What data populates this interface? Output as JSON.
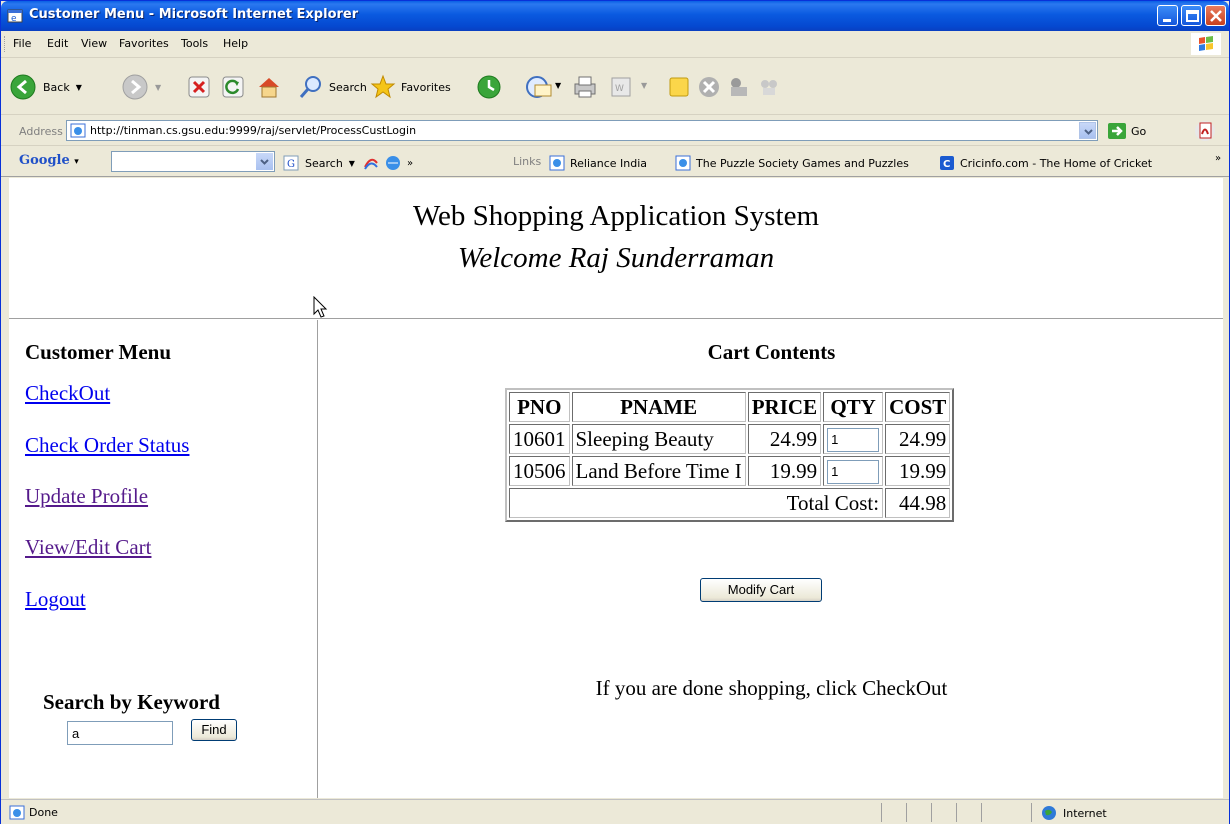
{
  "window": {
    "title": "Customer Menu - Microsoft Internet Explorer"
  },
  "menubar": {
    "items": [
      "File",
      "Edit",
      "View",
      "Favorites",
      "Tools",
      "Help"
    ]
  },
  "toolbar": {
    "back_label": "Back",
    "search_label": "Search",
    "favorites_label": "Favorites"
  },
  "addressbar": {
    "label": "Address",
    "url": "http://tinman.cs.gsu.edu:9999/raj/servlet/ProcessCustLogin",
    "go_label": "Go"
  },
  "googlebar": {
    "logo": "Google",
    "search_label": "Search",
    "links_label": "Links",
    "links": [
      "Reliance India",
      "The Puzzle Society Games and Puzzles",
      "Cricinfo.com - The Home of Cricket"
    ]
  },
  "page": {
    "header_title": "Web Shopping Application System",
    "welcome": "Welcome Raj Sunderraman",
    "menu": {
      "title": "Customer Menu",
      "links": [
        "CheckOut",
        "Check Order Status",
        "Update Profile",
        "View/Edit Cart",
        "Logout"
      ]
    },
    "search": {
      "title": "Search by Keyword",
      "value": "a",
      "button": "Find"
    },
    "cart": {
      "title": "Cart Contents",
      "columns": [
        "PNO",
        "PNAME",
        "PRICE",
        "QTY",
        "COST"
      ],
      "rows": [
        {
          "pno": "10601",
          "pname": "Sleeping Beauty",
          "price": "24.99",
          "qty": "1",
          "cost": "24.99"
        },
        {
          "pno": "10506",
          "pname": "Land Before Time I",
          "price": "19.99",
          "qty": "1",
          "cost": "19.99"
        }
      ],
      "total_label": "Total Cost:",
      "total_value": "44.98",
      "modify_button": "Modify Cart",
      "message": "If you are done shopping, click CheckOut"
    }
  },
  "statusbar": {
    "text": "Done",
    "zone": "Internet"
  }
}
